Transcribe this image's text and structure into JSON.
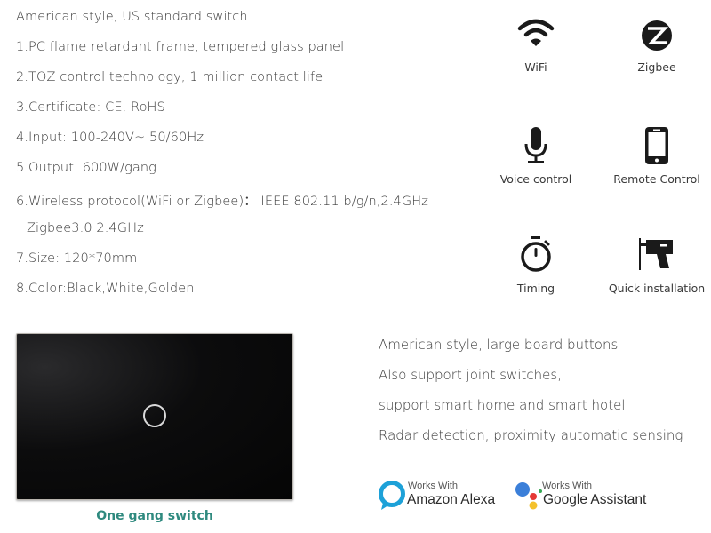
{
  "specs": {
    "title": "American style, US standard switch",
    "items": [
      "1.PC flame retardant frame, tempered glass panel",
      "2.TOZ control technology, 1 million contact life",
      "3.Certificate: CE, RoHS",
      "4.Input: 100-240V~ 50/60Hz",
      "5.Output: 600W/gang",
      "6.Wireless protocol(WiFi or Zigbee)：  IEEE 802.11 b/g/n,2.4GHz",
      "Zigbee3.0 2.4GHz",
      "7.Size: 120*70mm",
      "8.Color:Black,White,Golden"
    ]
  },
  "features": [
    {
      "icon": "wifi-icon",
      "label": "WiFi"
    },
    {
      "icon": "zigbee-icon",
      "label": "Zigbee"
    },
    {
      "icon": "microphone-icon",
      "label": "Voice control"
    },
    {
      "icon": "smartphone-icon",
      "label": "Remote Control"
    },
    {
      "icon": "stopwatch-icon",
      "label": "Timing"
    },
    {
      "icon": "drill-icon",
      "label": "Quick installation"
    }
  ],
  "product": {
    "caption": "One gang switch",
    "caption_color": "#2f8a7f",
    "panel_color": "#0a0a0a"
  },
  "description": [
    "American style, large board buttons",
    "Also support joint switches,",
    "support smart home and smart hotel",
    "Radar detection, proximity automatic sensing"
  ],
  "badges": {
    "alexa": {
      "small": "Works With",
      "big": "Amazon Alexa",
      "color": "#1da1d8"
    },
    "google": {
      "small": "Works With",
      "big": "Google Assistant",
      "colors": {
        "blue": "#3b7fd9",
        "red": "#e53935",
        "yellow": "#f4c12c",
        "green": "#34a853"
      }
    }
  }
}
